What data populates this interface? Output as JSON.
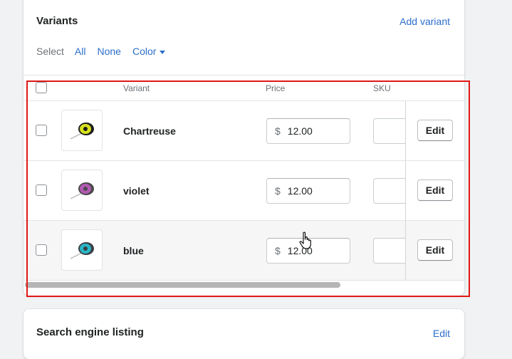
{
  "variants": {
    "title": "Variants",
    "add_link": "Add variant",
    "select": {
      "label": "Select",
      "options": [
        "All",
        "None",
        "Color"
      ]
    },
    "columns": {
      "variant": "Variant",
      "price": "Price",
      "sku": "SKU"
    },
    "currency_symbol": "$",
    "rows": [
      {
        "name": "Chartreuse",
        "price": "12.00",
        "sku": "",
        "edit_label": "Edit",
        "thumb_color": "#d8e21c"
      },
      {
        "name": "violet",
        "price": "12.00",
        "sku": "",
        "edit_label": "Edit",
        "thumb_color": "#b45ab4"
      },
      {
        "name": "blue",
        "price": "12.00",
        "sku": "",
        "edit_label": "Edit",
        "thumb_color": "#2ab6c8"
      }
    ]
  },
  "seo": {
    "title": "Search engine listing",
    "edit_link": "Edit"
  },
  "colors": {
    "link": "#2c6ecb",
    "annotation_border": "#e01818"
  },
  "icons": [
    "caret-down-icon",
    "leash-thumbnail-icon",
    "pointer-hand-cursor-icon"
  ]
}
